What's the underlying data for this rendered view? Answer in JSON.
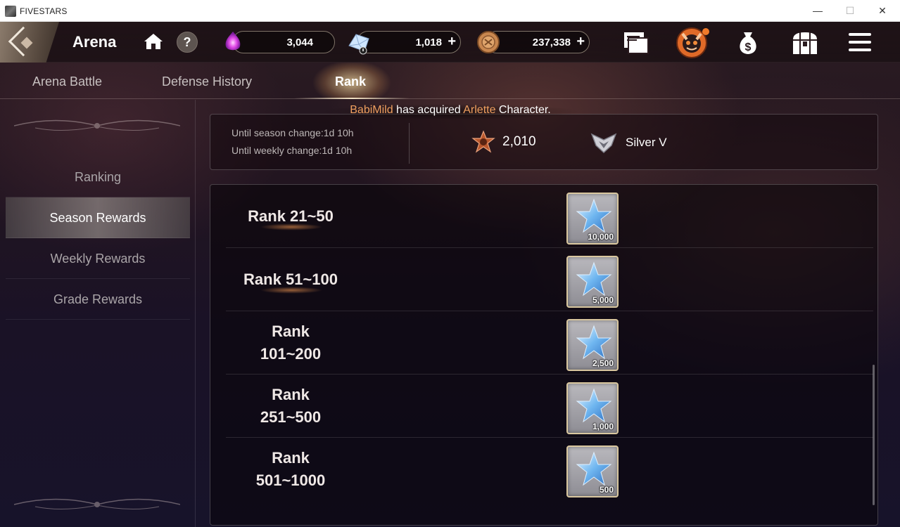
{
  "window": {
    "app_title": "FIVESTARS",
    "min": "—",
    "max": "☐",
    "close": "✕"
  },
  "hud": {
    "title": "Arena",
    "help": "?",
    "currencies": [
      {
        "icon": "soul-gem-icon",
        "value": "3,044"
      },
      {
        "icon": "crystal-icon",
        "value": "1,018",
        "plus": "+"
      },
      {
        "icon": "coin-icon",
        "value": "237,338",
        "plus": "+"
      }
    ],
    "icons": [
      "mail-icon",
      "event-icon",
      "shop-icon",
      "chest-icon",
      "menu-icon"
    ],
    "badge_color": "#f07a2a"
  },
  "tabs": [
    {
      "label": "Arena Battle",
      "active": false
    },
    {
      "label": "Defense History",
      "active": false
    },
    {
      "label": "Rank",
      "active": true
    }
  ],
  "sidebar": {
    "items": [
      {
        "label": "Ranking",
        "active": false
      },
      {
        "label": "Season Rewards",
        "active": true
      },
      {
        "label": "Weekly Rewards",
        "active": false
      },
      {
        "label": "Grade Rewards",
        "active": false
      }
    ]
  },
  "notice": {
    "player": "BabiMild",
    "middle": " has acquired ",
    "item": "Arlette",
    "suffix": " Character."
  },
  "info": {
    "season_timer": "Until season change:1d 10h",
    "weekly_timer": "Until weekly change:1d 10h",
    "score": "2,010",
    "grade": "Silver V"
  },
  "rewards": [
    {
      "rank": "Rank 21~50",
      "quantity": "10,000"
    },
    {
      "rank": "Rank 51~100",
      "quantity": "5,000"
    },
    {
      "rank_line1": "Rank",
      "rank_line2": "101~200",
      "quantity": "2,500"
    },
    {
      "rank_line1": "Rank",
      "rank_line2": "251~500",
      "quantity": "1,000"
    },
    {
      "rank_line1": "Rank",
      "rank_line2": "501~1000",
      "quantity": "500"
    }
  ],
  "colors": {
    "highlight": "#f0a060",
    "frame": "#d9c79f"
  }
}
